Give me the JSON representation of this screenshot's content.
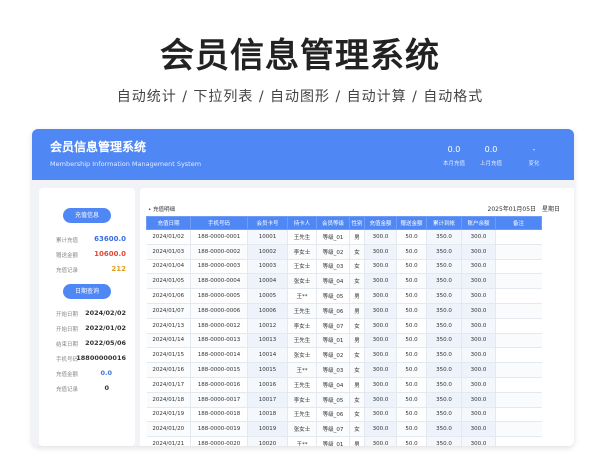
{
  "hero": {
    "title": "会员信息管理系统",
    "subtitle": "自动统计 / 下拉列表 / 自动图形 / 自动计算 / 自动格式"
  },
  "banner": {
    "title": "会员信息管理系统",
    "subtitle": "Membership Information Management System",
    "stats": [
      {
        "value": "0.0",
        "label": "本月充值"
      },
      {
        "value": "0.0",
        "label": "上月充值"
      },
      {
        "value": "-",
        "label": "变化"
      }
    ]
  },
  "left": {
    "pill1": "充值信息",
    "summary": [
      {
        "key": "累计充值",
        "value": "63600.0"
      },
      {
        "key": "赠送金额",
        "value": "10600.0"
      },
      {
        "key": "充值记录",
        "value": "212"
      }
    ],
    "pill2": "日期查询",
    "details": [
      {
        "key": "开始日期",
        "value": "2024/02/02"
      },
      {
        "key": "开始日期",
        "value": "2022/01/02"
      },
      {
        "key": "结束日期",
        "value": "2022/05/06"
      },
      {
        "key": "手机号码",
        "value": "18800000016"
      },
      {
        "key": "充值金额",
        "value": "0.0"
      },
      {
        "key": "充值记录",
        "value": "0"
      }
    ]
  },
  "main": {
    "section_label": "• 充值明细",
    "date": "2025年01月05日",
    "weekday": "星期日",
    "columns": [
      "充值日期",
      "手机号码",
      "会员卡号",
      "持卡人",
      "会员等级",
      "性别",
      "充值金额",
      "赠送金额",
      "累计到帐",
      "账户余额",
      "备注"
    ],
    "rows": [
      [
        "2024/01/02",
        "188-0000-0001",
        "10001",
        "王先生",
        "等级_01",
        "男",
        "300.0",
        "50.0",
        "350.0",
        "300.0",
        ""
      ],
      [
        "2024/01/03",
        "188-0000-0002",
        "10002",
        "李女士",
        "等级_02",
        "女",
        "300.0",
        "50.0",
        "350.0",
        "300.0",
        ""
      ],
      [
        "2024/01/04",
        "188-0000-0003",
        "10003",
        "王女士",
        "等级_03",
        "女",
        "300.0",
        "50.0",
        "350.0",
        "300.0",
        ""
      ],
      [
        "2024/01/05",
        "188-0000-0004",
        "10004",
        "张女士",
        "等级_04",
        "女",
        "300.0",
        "50.0",
        "350.0",
        "300.0",
        ""
      ],
      [
        "2024/01/06",
        "188-0000-0005",
        "10005",
        "王**",
        "等级_05",
        "男",
        "300.0",
        "50.0",
        "350.0",
        "300.0",
        ""
      ],
      [
        "2024/01/07",
        "188-0000-0006",
        "10006",
        "王先生",
        "等级_06",
        "男",
        "300.0",
        "50.0",
        "350.0",
        "300.0",
        ""
      ],
      [
        "2024/01/13",
        "188-0000-0012",
        "10012",
        "李女士",
        "等级_07",
        "女",
        "300.0",
        "50.0",
        "350.0",
        "300.0",
        ""
      ],
      [
        "2024/01/14",
        "188-0000-0013",
        "10013",
        "王先生",
        "等级_01",
        "男",
        "300.0",
        "50.0",
        "350.0",
        "300.0",
        ""
      ],
      [
        "2024/01/15",
        "188-0000-0014",
        "10014",
        "张女士",
        "等级_02",
        "女",
        "300.0",
        "50.0",
        "350.0",
        "300.0",
        ""
      ],
      [
        "2024/01/16",
        "188-0000-0015",
        "10015",
        "王**",
        "等级_03",
        "女",
        "300.0",
        "50.0",
        "350.0",
        "300.0",
        ""
      ],
      [
        "2024/01/17",
        "188-0000-0016",
        "10016",
        "王先生",
        "等级_04",
        "男",
        "300.0",
        "50.0",
        "350.0",
        "300.0",
        ""
      ],
      [
        "2024/01/18",
        "188-0000-0017",
        "10017",
        "李女士",
        "等级_05",
        "女",
        "300.0",
        "50.0",
        "350.0",
        "300.0",
        ""
      ],
      [
        "2024/01/19",
        "188-0000-0018",
        "10018",
        "王先生",
        "等级_06",
        "女",
        "300.0",
        "50.0",
        "350.0",
        "300.0",
        ""
      ],
      [
        "2024/01/20",
        "188-0000-0019",
        "10019",
        "张女士",
        "等级_07",
        "女",
        "300.0",
        "50.0",
        "350.0",
        "300.0",
        ""
      ],
      [
        "2024/01/21",
        "188-0000-0020",
        "10020",
        "王**",
        "等级_01",
        "男",
        "300.0",
        "50.0",
        "350.0",
        "300.0",
        ""
      ]
    ]
  }
}
